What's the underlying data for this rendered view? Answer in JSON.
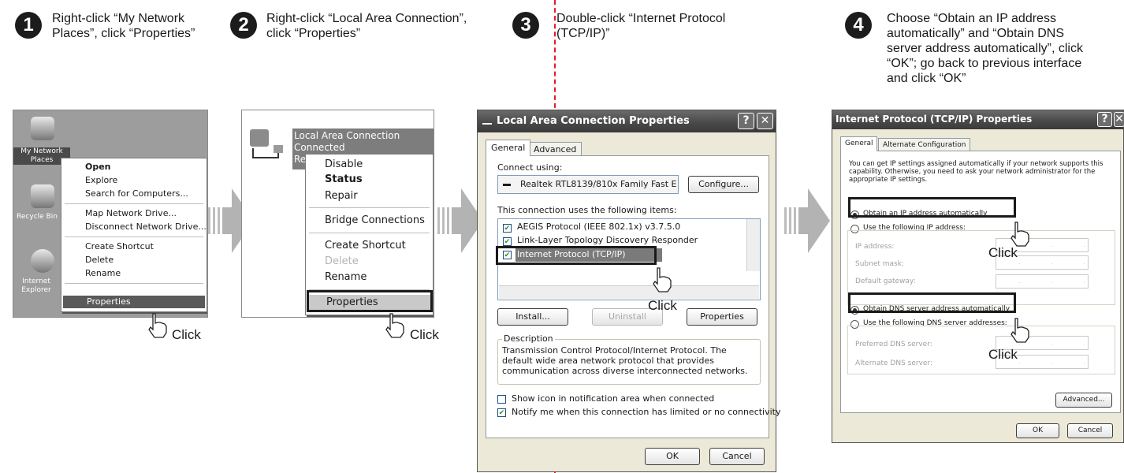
{
  "steps": [
    {
      "number": "1",
      "text": "Right-click “My Network Places”, click “Properties”"
    },
    {
      "number": "2",
      "text": "Right-click “Local Area Connection”, click “Properties”"
    },
    {
      "number": "3",
      "text": "Double-click “Internet Protocol (TCP/IP)”"
    },
    {
      "number": "4",
      "text": "Choose “Obtain an IP address automatically” and “Obtain DNS server address automatically”, click “OK”; go back to previous interface and click “OK”"
    }
  ],
  "click_label": "Click",
  "panel1": {
    "desktop_icons": [
      "My Network Places",
      "Recycle Bin",
      "Internet Explorer"
    ],
    "menu": {
      "open": "Open",
      "explore": "Explore",
      "search": "Search for Computers...",
      "map_drive": "Map Network Drive...",
      "disconnect_drive": "Disconnect Network Drive...",
      "create_shortcut": "Create Shortcut",
      "delete": "Delete",
      "rename": "Rename",
      "properties": "Properties"
    }
  },
  "panel2": {
    "connection_name": "Local Area Connection",
    "connection_status": "Connected",
    "connection_device_partial": "Re",
    "menu": {
      "disable": "Disable",
      "status": "Status",
      "repair": "Repair",
      "bridge": "Bridge Connections",
      "create_shortcut": "Create Shortcut",
      "delete": "Delete",
      "rename": "Rename",
      "properties": "Properties"
    }
  },
  "dialog3": {
    "title": "Local Area Connection Properties",
    "tabs": [
      "General",
      "Advanced"
    ],
    "connect_using_label": "Connect using:",
    "adapter": "Realtek RTL8139/810x Family Fast E",
    "configure_button": "Configure...",
    "items_label": "This connection uses the following items:",
    "items": [
      "AEGIS Protocol (IEEE 802.1x) v3.7.5.0",
      "Link-Layer Topology Discovery Responder",
      "Internet Protocol (TCP/IP)"
    ],
    "install_button": "Install...",
    "uninstall_button": "Uninstall",
    "properties_button": "Properties",
    "description_label": "Description",
    "description_text": "Transmission Control Protocol/Internet Protocol. The default wide area network protocol that provides communication across diverse interconnected networks.",
    "show_icon_label": "Show icon in notification area when connected",
    "notify_label": "Notify me when this connection has limited or no connectivity",
    "ok_button": "OK",
    "cancel_button": "Cancel"
  },
  "dialog4": {
    "title": "Internet Protocol (TCP/IP) Properties",
    "tabs": [
      "General",
      "Alternate Configuration"
    ],
    "intro_text": "You can get IP settings assigned automatically if your network supports this capability. Otherwise, you need to ask your network administrator for the appropriate IP settings.",
    "obtain_ip_label": "Obtain an IP address automatically",
    "use_ip_label": "Use the following IP address:",
    "ip_address_label": "IP address:",
    "subnet_label": "Subnet mask:",
    "gateway_label": "Default gateway:",
    "obtain_dns_label": "Obtain DNS server address automatically",
    "use_dns_label": "Use the following DNS server addresses:",
    "preferred_dns_label": "Preferred DNS server:",
    "alternate_dns_label": "Alternate DNS server:",
    "advanced_button": "Advanced...",
    "ok_button": "OK",
    "cancel_button": "Cancel"
  },
  "colors": {
    "divider_red": "#e8182b",
    "titlebar_gray": "#4a4a4a",
    "dialog_bg": "#ece9d8"
  }
}
